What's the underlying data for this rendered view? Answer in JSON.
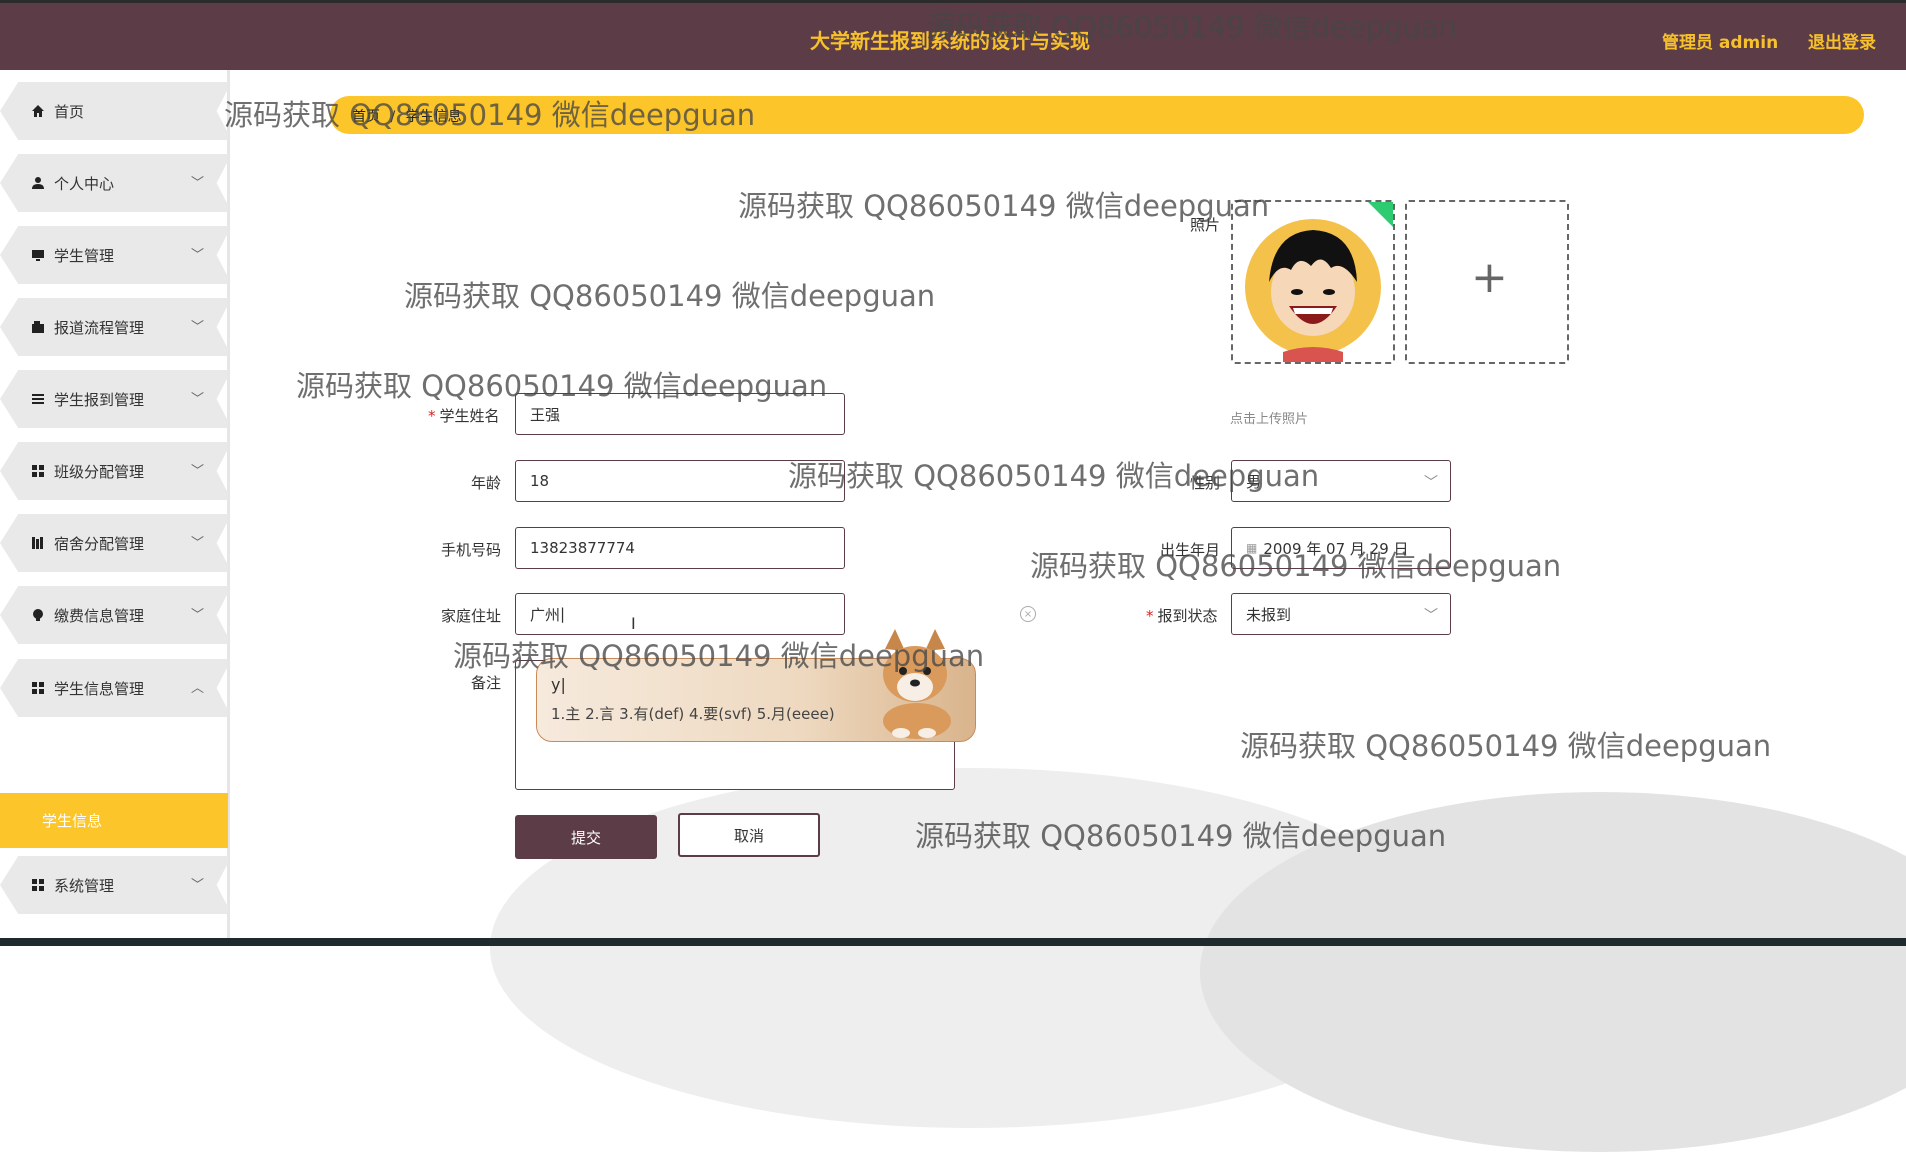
{
  "header": {
    "title": "大学新生报到系统的设计与实现",
    "admin": "管理员 admin",
    "logout": "退出登录"
  },
  "sidebar": {
    "items": [
      {
        "label": "首页",
        "icon": "home-icon"
      },
      {
        "label": "个人中心",
        "icon": "user-icon"
      },
      {
        "label": "学生管理",
        "icon": "monitor-icon"
      },
      {
        "label": "报道流程管理",
        "icon": "wallet-icon"
      },
      {
        "label": "学生报到管理",
        "icon": "list-icon"
      },
      {
        "label": "班级分配管理",
        "icon": "grid-icon"
      },
      {
        "label": "宿舍分配管理",
        "icon": "books-icon"
      },
      {
        "label": "缴费信息管理",
        "icon": "bulb-icon"
      },
      {
        "label": "学生信息管理",
        "icon": "grid-icon"
      },
      {
        "label": "系统管理",
        "icon": "grid-icon"
      }
    ],
    "active_sub": "学生信息"
  },
  "breadcrumb": {
    "home": "首页",
    "current": "学生信息"
  },
  "form": {
    "photo_label": "照片",
    "photo_hint": "点击上传照片",
    "name_label": "学生姓名",
    "name_value": "王强",
    "age_label": "年龄",
    "age_value": "18",
    "gender_label": "性别",
    "gender_value": "男",
    "phone_label": "手机号码",
    "phone_value": "13823877774",
    "birth_label": "出生年月",
    "birth_value": "2009 年 07 月 29 日",
    "address_label": "家庭住址",
    "address_value": "广州",
    "status_label": "报到状态",
    "status_value": "未报到",
    "remark_label": "备注",
    "submit": "提交",
    "cancel": "取消"
  },
  "ime": {
    "input": "y|",
    "candidates": "1.主  2.言  3.有(def)  4.要(svf)  5.月(eeee)"
  },
  "watermark": "源码获取 QQ86050149 微信deepguan",
  "colors": {
    "header_bg": "#5b3c47",
    "accent_yellow": "#fcc52a",
    "title_yellow": "#f7c12c"
  }
}
